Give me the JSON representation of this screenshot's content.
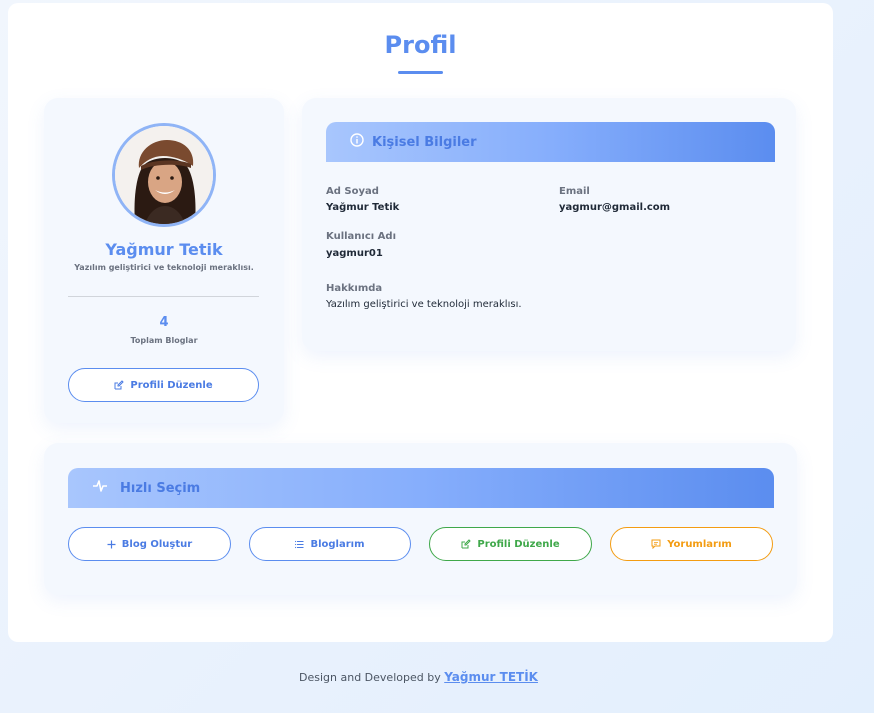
{
  "page": {
    "title": "Profil"
  },
  "profile": {
    "name": "Yağmur Tetik",
    "subtitle": "Yazılım geliştirici ve teknoloji meraklısı.",
    "stat_value": "4",
    "stat_label": "Toplam Bloglar",
    "edit_button": "Profili Düzenle",
    "avatar_icon": "user-photo"
  },
  "personal_info": {
    "header": "Kişisel Bilgiler",
    "header_icon": "info-circle-icon",
    "fields": {
      "fullname": {
        "label": "Ad Soyad",
        "value": "Yağmur Tetik"
      },
      "email": {
        "label": "Email",
        "value": "yagmur@gmail.com"
      },
      "username": {
        "label": "Kullanıcı Adı",
        "value": "yagmur01"
      },
      "about": {
        "label": "Hakkımda",
        "value": "Yazılım geliştirici ve teknoloji meraklısı."
      }
    }
  },
  "quick_select": {
    "header": "Hızlı Seçim",
    "header_icon": "activity-icon",
    "buttons": [
      {
        "label": "Blog Oluştur",
        "icon": "plus-icon",
        "color": "#5b8def"
      },
      {
        "label": "Bloglarım",
        "icon": "list-icon",
        "color": "#5b8def"
      },
      {
        "label": "Profili Düzenle",
        "icon": "edit-icon",
        "color": "#3fa84a"
      },
      {
        "label": "Yorumlarım",
        "icon": "comment-icon",
        "color": "#f39c12"
      }
    ]
  },
  "footer": {
    "text": "Design and Developed by",
    "author": "Yağmur TETİK"
  },
  "colors": {
    "accent": "#5b8def",
    "green": "#3fa84a",
    "orange": "#f39c12"
  }
}
